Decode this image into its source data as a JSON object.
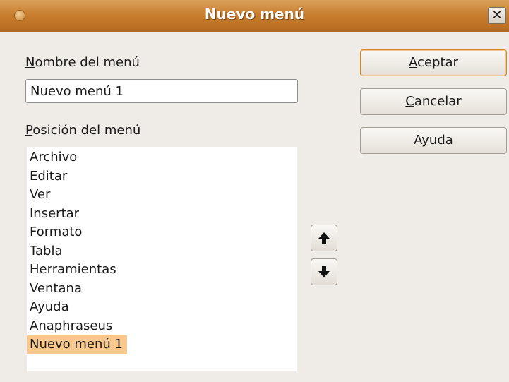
{
  "window": {
    "title": "Nuevo menú",
    "close_glyph": "✕"
  },
  "form": {
    "name_label_key": "N",
    "name_label_rest": "ombre del menú",
    "name_value": "Nuevo menú 1",
    "position_label_key": "P",
    "position_label_rest": "osición del menú"
  },
  "menu_list": {
    "items": [
      "Archivo",
      "Editar",
      "Ver",
      "Insertar",
      "Formato",
      "Tabla",
      "Herramientas",
      "Ventana",
      "Ayuda",
      "Anaphraseus",
      "Nuevo menú 1"
    ],
    "selected_index": 10
  },
  "buttons": {
    "ok_key": "A",
    "ok_rest": "ceptar",
    "cancel_key": "C",
    "cancel_rest": "ancelar",
    "help_pre": "Ay",
    "help_key": "u",
    "help_rest": "da",
    "move_up_icon": "arrow-up-icon",
    "move_down_icon": "arrow-down-icon"
  },
  "colors": {
    "titlebar": "#c97f2f",
    "selection": "#f9c88d",
    "background": "#efebe7"
  }
}
